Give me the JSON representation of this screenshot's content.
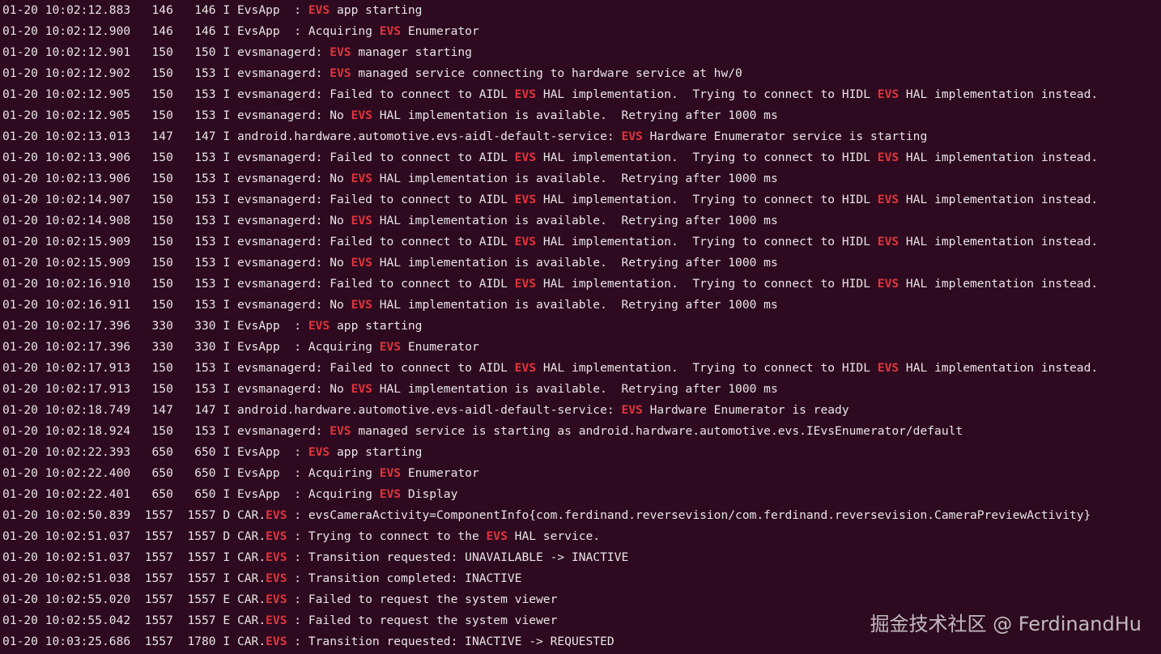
{
  "colors": {
    "background": "#2d0a1f",
    "text": "#e8e4e6",
    "highlight": "#e0343c"
  },
  "terminal": {
    "lines": [
      {
        "ts": "01-20 10:02:12.883",
        "pid": "146",
        "tid": "146",
        "level": "I",
        "tag": "EvsApp  ",
        "tag_hl": "",
        "msg": [
          {
            "t": "",
            "h": ""
          },
          {
            "t": "",
            "h": "EVS"
          },
          {
            "t": " app starting",
            "h": ""
          }
        ]
      },
      {
        "ts": "01-20 10:02:12.900",
        "pid": "146",
        "tid": "146",
        "level": "I",
        "tag": "EvsApp  ",
        "tag_hl": "",
        "msg": [
          {
            "t": "Acquiring ",
            "h": ""
          },
          {
            "t": "",
            "h": "EVS"
          },
          {
            "t": " Enumerator",
            "h": ""
          }
        ]
      },
      {
        "ts": "01-20 10:02:12.901",
        "pid": "150",
        "tid": "150",
        "level": "I",
        "tag": "evsmanagerd",
        "tag_hl": "",
        "msg": [
          {
            "t": "",
            "h": ""
          },
          {
            "t": "",
            "h": "EVS"
          },
          {
            "t": " manager starting",
            "h": ""
          }
        ]
      },
      {
        "ts": "01-20 10:02:12.902",
        "pid": "150",
        "tid": "153",
        "level": "I",
        "tag": "evsmanagerd",
        "tag_hl": "",
        "msg": [
          {
            "t": "",
            "h": ""
          },
          {
            "t": "",
            "h": "EVS"
          },
          {
            "t": " managed service connecting to hardware service at hw/0",
            "h": ""
          }
        ]
      },
      {
        "ts": "01-20 10:02:12.905",
        "pid": "150",
        "tid": "153",
        "level": "I",
        "tag": "evsmanagerd",
        "tag_hl": "",
        "msg": [
          {
            "t": "Failed to connect to AIDL ",
            "h": ""
          },
          {
            "t": "",
            "h": "EVS"
          },
          {
            "t": " HAL implementation.  Trying to connect to HIDL ",
            "h": ""
          },
          {
            "t": "",
            "h": "EVS"
          },
          {
            "t": " HAL implementation instead.",
            "h": ""
          }
        ]
      },
      {
        "ts": "01-20 10:02:12.905",
        "pid": "150",
        "tid": "153",
        "level": "I",
        "tag": "evsmanagerd",
        "tag_hl": "",
        "msg": [
          {
            "t": "No ",
            "h": ""
          },
          {
            "t": "",
            "h": "EVS"
          },
          {
            "t": " HAL implementation is available.  Retrying after 1000 ms",
            "h": ""
          }
        ]
      },
      {
        "ts": "01-20 10:02:13.013",
        "pid": "147",
        "tid": "147",
        "level": "I",
        "tag": "android.hardware.automotive.evs-aidl-default-service",
        "tag_hl": "",
        "msg": [
          {
            "t": "",
            "h": ""
          },
          {
            "t": "",
            "h": "EVS"
          },
          {
            "t": " Hardware Enumerator service is starting",
            "h": ""
          }
        ]
      },
      {
        "ts": "01-20 10:02:13.906",
        "pid": "150",
        "tid": "153",
        "level": "I",
        "tag": "evsmanagerd",
        "tag_hl": "",
        "msg": [
          {
            "t": "Failed to connect to AIDL ",
            "h": ""
          },
          {
            "t": "",
            "h": "EVS"
          },
          {
            "t": " HAL implementation.  Trying to connect to HIDL ",
            "h": ""
          },
          {
            "t": "",
            "h": "EVS"
          },
          {
            "t": " HAL implementation instead.",
            "h": ""
          }
        ]
      },
      {
        "ts": "01-20 10:02:13.906",
        "pid": "150",
        "tid": "153",
        "level": "I",
        "tag": "evsmanagerd",
        "tag_hl": "",
        "msg": [
          {
            "t": "No ",
            "h": ""
          },
          {
            "t": "",
            "h": "EVS"
          },
          {
            "t": " HAL implementation is available.  Retrying after 1000 ms",
            "h": ""
          }
        ]
      },
      {
        "ts": "01-20 10:02:14.907",
        "pid": "150",
        "tid": "153",
        "level": "I",
        "tag": "evsmanagerd",
        "tag_hl": "",
        "msg": [
          {
            "t": "Failed to connect to AIDL ",
            "h": ""
          },
          {
            "t": "",
            "h": "EVS"
          },
          {
            "t": " HAL implementation.  Trying to connect to HIDL ",
            "h": ""
          },
          {
            "t": "",
            "h": "EVS"
          },
          {
            "t": " HAL implementation instead.",
            "h": ""
          }
        ]
      },
      {
        "ts": "01-20 10:02:14.908",
        "pid": "150",
        "tid": "153",
        "level": "I",
        "tag": "evsmanagerd",
        "tag_hl": "",
        "msg": [
          {
            "t": "No ",
            "h": ""
          },
          {
            "t": "",
            "h": "EVS"
          },
          {
            "t": " HAL implementation is available.  Retrying after 1000 ms",
            "h": ""
          }
        ]
      },
      {
        "ts": "01-20 10:02:15.909",
        "pid": "150",
        "tid": "153",
        "level": "I",
        "tag": "evsmanagerd",
        "tag_hl": "",
        "msg": [
          {
            "t": "Failed to connect to AIDL ",
            "h": ""
          },
          {
            "t": "",
            "h": "EVS"
          },
          {
            "t": " HAL implementation.  Trying to connect to HIDL ",
            "h": ""
          },
          {
            "t": "",
            "h": "EVS"
          },
          {
            "t": " HAL implementation instead.",
            "h": ""
          }
        ]
      },
      {
        "ts": "01-20 10:02:15.909",
        "pid": "150",
        "tid": "153",
        "level": "I",
        "tag": "evsmanagerd",
        "tag_hl": "",
        "msg": [
          {
            "t": "No ",
            "h": ""
          },
          {
            "t": "",
            "h": "EVS"
          },
          {
            "t": " HAL implementation is available.  Retrying after 1000 ms",
            "h": ""
          }
        ]
      },
      {
        "ts": "01-20 10:02:16.910",
        "pid": "150",
        "tid": "153",
        "level": "I",
        "tag": "evsmanagerd",
        "tag_hl": "",
        "msg": [
          {
            "t": "Failed to connect to AIDL ",
            "h": ""
          },
          {
            "t": "",
            "h": "EVS"
          },
          {
            "t": " HAL implementation.  Trying to connect to HIDL ",
            "h": ""
          },
          {
            "t": "",
            "h": "EVS"
          },
          {
            "t": " HAL implementation instead.",
            "h": ""
          }
        ]
      },
      {
        "ts": "01-20 10:02:16.911",
        "pid": "150",
        "tid": "153",
        "level": "I",
        "tag": "evsmanagerd",
        "tag_hl": "",
        "msg": [
          {
            "t": "No ",
            "h": ""
          },
          {
            "t": "",
            "h": "EVS"
          },
          {
            "t": " HAL implementation is available.  Retrying after 1000 ms",
            "h": ""
          }
        ]
      },
      {
        "ts": "01-20 10:02:17.396",
        "pid": "330",
        "tid": "330",
        "level": "I",
        "tag": "EvsApp  ",
        "tag_hl": "",
        "msg": [
          {
            "t": "",
            "h": ""
          },
          {
            "t": "",
            "h": "EVS"
          },
          {
            "t": " app starting",
            "h": ""
          }
        ]
      },
      {
        "ts": "01-20 10:02:17.396",
        "pid": "330",
        "tid": "330",
        "level": "I",
        "tag": "EvsApp  ",
        "tag_hl": "",
        "msg": [
          {
            "t": "Acquiring ",
            "h": ""
          },
          {
            "t": "",
            "h": "EVS"
          },
          {
            "t": " Enumerator",
            "h": ""
          }
        ]
      },
      {
        "ts": "01-20 10:02:17.913",
        "pid": "150",
        "tid": "153",
        "level": "I",
        "tag": "evsmanagerd",
        "tag_hl": "",
        "msg": [
          {
            "t": "Failed to connect to AIDL ",
            "h": ""
          },
          {
            "t": "",
            "h": "EVS"
          },
          {
            "t": " HAL implementation.  Trying to connect to HIDL ",
            "h": ""
          },
          {
            "t": "",
            "h": "EVS"
          },
          {
            "t": " HAL implementation instead.",
            "h": ""
          }
        ]
      },
      {
        "ts": "01-20 10:02:17.913",
        "pid": "150",
        "tid": "153",
        "level": "I",
        "tag": "evsmanagerd",
        "tag_hl": "",
        "msg": [
          {
            "t": "No ",
            "h": ""
          },
          {
            "t": "",
            "h": "EVS"
          },
          {
            "t": " HAL implementation is available.  Retrying after 1000 ms",
            "h": ""
          }
        ]
      },
      {
        "ts": "01-20 10:02:18.749",
        "pid": "147",
        "tid": "147",
        "level": "I",
        "tag": "android.hardware.automotive.evs-aidl-default-service",
        "tag_hl": "",
        "msg": [
          {
            "t": "",
            "h": ""
          },
          {
            "t": "",
            "h": "EVS"
          },
          {
            "t": " Hardware Enumerator is ready",
            "h": ""
          }
        ]
      },
      {
        "ts": "01-20 10:02:18.924",
        "pid": "150",
        "tid": "153",
        "level": "I",
        "tag": "evsmanagerd",
        "tag_hl": "",
        "msg": [
          {
            "t": "",
            "h": ""
          },
          {
            "t": "",
            "h": "EVS"
          },
          {
            "t": " managed service is starting as android.hardware.automotive.evs.IEvsEnumerator/default",
            "h": ""
          }
        ]
      },
      {
        "ts": "01-20 10:02:22.393",
        "pid": "650",
        "tid": "650",
        "level": "I",
        "tag": "EvsApp  ",
        "tag_hl": "",
        "msg": [
          {
            "t": "",
            "h": ""
          },
          {
            "t": "",
            "h": "EVS"
          },
          {
            "t": " app starting",
            "h": ""
          }
        ]
      },
      {
        "ts": "01-20 10:02:22.400",
        "pid": "650",
        "tid": "650",
        "level": "I",
        "tag": "EvsApp  ",
        "tag_hl": "",
        "msg": [
          {
            "t": "Acquiring ",
            "h": ""
          },
          {
            "t": "",
            "h": "EVS"
          },
          {
            "t": " Enumerator",
            "h": ""
          }
        ]
      },
      {
        "ts": "01-20 10:02:22.401",
        "pid": "650",
        "tid": "650",
        "level": "I",
        "tag": "EvsApp  ",
        "tag_hl": "",
        "msg": [
          {
            "t": "Acquiring ",
            "h": ""
          },
          {
            "t": "",
            "h": "EVS"
          },
          {
            "t": " Display",
            "h": ""
          }
        ]
      },
      {
        "ts": "01-20 10:02:50.839",
        "pid": "1557",
        "tid": "1557",
        "level": "D",
        "tag": "CAR.",
        "tag_hl": "EVS",
        "msg": [
          {
            "t": "evsCameraActivity=ComponentInfo{com.ferdinand.reversevision/com.ferdinand.reversevision.CameraPreviewActivity}",
            "h": ""
          }
        ]
      },
      {
        "ts": "01-20 10:02:51.037",
        "pid": "1557",
        "tid": "1557",
        "level": "D",
        "tag": "CAR.",
        "tag_hl": "EVS",
        "msg": [
          {
            "t": "Trying to connect to the ",
            "h": ""
          },
          {
            "t": "",
            "h": "EVS"
          },
          {
            "t": " HAL service.",
            "h": ""
          }
        ]
      },
      {
        "ts": "01-20 10:02:51.037",
        "pid": "1557",
        "tid": "1557",
        "level": "I",
        "tag": "CAR.",
        "tag_hl": "EVS",
        "msg": [
          {
            "t": "Transition requested: UNAVAILABLE -> INACTIVE",
            "h": ""
          }
        ]
      },
      {
        "ts": "01-20 10:02:51.038",
        "pid": "1557",
        "tid": "1557",
        "level": "I",
        "tag": "CAR.",
        "tag_hl": "EVS",
        "msg": [
          {
            "t": "Transition completed: INACTIVE",
            "h": ""
          }
        ]
      },
      {
        "ts": "01-20 10:02:55.020",
        "pid": "1557",
        "tid": "1557",
        "level": "E",
        "tag": "CAR.",
        "tag_hl": "EVS",
        "msg": [
          {
            "t": "Failed to request the system viewer",
            "h": ""
          }
        ]
      },
      {
        "ts": "01-20 10:02:55.042",
        "pid": "1557",
        "tid": "1557",
        "level": "E",
        "tag": "CAR.",
        "tag_hl": "EVS",
        "msg": [
          {
            "t": "Failed to request the system viewer",
            "h": ""
          }
        ]
      },
      {
        "ts": "01-20 10:03:25.686",
        "pid": "1557",
        "tid": "1780",
        "level": "I",
        "tag": "CAR.",
        "tag_hl": "EVS",
        "msg": [
          {
            "t": "Transition requested: INACTIVE -> REQUESTED",
            "h": ""
          }
        ]
      }
    ]
  },
  "watermark": "掘金技术社区 @ FerdinandHu"
}
